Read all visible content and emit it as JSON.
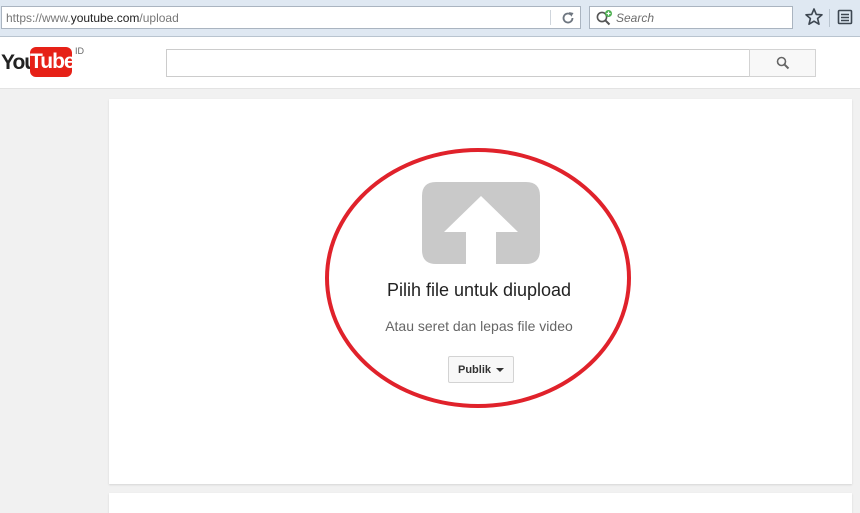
{
  "browser": {
    "url_prefix": "https://www.",
    "url_host": "youtube.com",
    "url_path": "/upload",
    "search_placeholder": "Search",
    "icons": {
      "reload": "reload-icon",
      "search_engine": "search-engine-icon",
      "bookmark_star": "star-icon",
      "bookmarks_menu": "bookmarks-icon"
    }
  },
  "header": {
    "logo_you": "You",
    "logo_tube": "Tube",
    "country": "ID",
    "search_value": "",
    "search_icon": "search-icon"
  },
  "upload": {
    "title": "Pilih file untuk diupload",
    "subtitle": "Atau seret dan lepas file video",
    "privacy_label": "Publik",
    "icon": "upload-arrow-icon"
  },
  "colors": {
    "brand_red": "#e62117",
    "highlight_ring": "#e0222b",
    "upload_icon": "#c9c9c9"
  }
}
